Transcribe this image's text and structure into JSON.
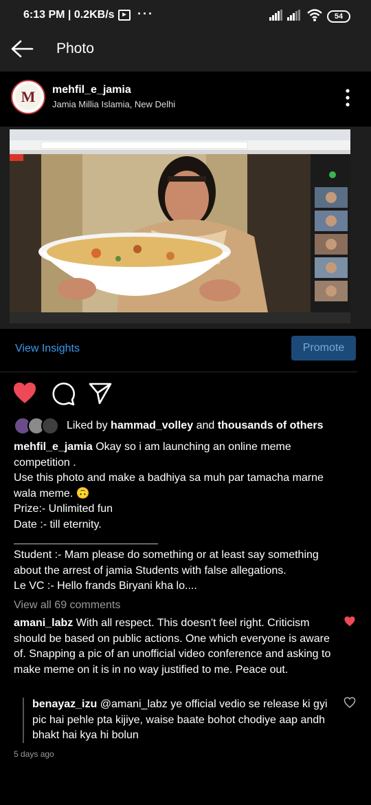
{
  "status_bar": {
    "time": "6:13 PM | 0.2KB/s",
    "dots": "···",
    "battery": "54",
    "icons": [
      "media-icon",
      "signal-icon",
      "signal-icon",
      "wifi-icon",
      "battery-icon"
    ]
  },
  "app_bar": {
    "title": "Photo",
    "back_icon": "arrow-left-icon"
  },
  "post": {
    "avatar_letter": "M",
    "username": "mehfil_e_jamia",
    "location": "Jamia Millia Islamia, New Delhi",
    "more_icon": "more-vertical-icon"
  },
  "insights": {
    "view_label": "View Insights",
    "promote_label": "Promote"
  },
  "actions": {
    "like_icon": "heart-filled-icon",
    "comment_icon": "comment-icon",
    "share_icon": "send-icon",
    "like_color": "#ed4956"
  },
  "likes": {
    "prefix": "Liked by",
    "user": "hammad_volley",
    "middle": "and",
    "others": "thousands of others"
  },
  "caption": {
    "username": "mehfil_e_jamia",
    "line1": "Okay so i am launching an online meme competition .",
    "line2": "Use this photo and make a badhiya sa muh par tamacha marne wala meme. 🙃",
    "line3": "Prize:- Unlimited fun",
    "line4": "Date :- till eternity.",
    "line5": "Student :- Mam please do something or at least say something about the arrest of jamia Students with false allegations.",
    "line6": "Le VC :- Hello frands Biryani kha lo...."
  },
  "comments": {
    "view_all": "View all 69 comments",
    "items": [
      {
        "username": "amani_labz",
        "text": "With all respect. This doesn't feel right. Criticism should be based on public actions. One which everyone is aware of. Snapping a pic of an unofficial video conference and asking to make meme on it is in no way justified to me. Peace out.",
        "liked": true
      },
      {
        "username": "benayaz_izu",
        "text": "@amani_labz ye official vedio se release ki gyi pic hai pehle pta kijiye, waise baate bohot chodiye aap andh bhakt hai kya hi bolun",
        "liked": false
      }
    ],
    "timestamp": "5 days ago"
  }
}
